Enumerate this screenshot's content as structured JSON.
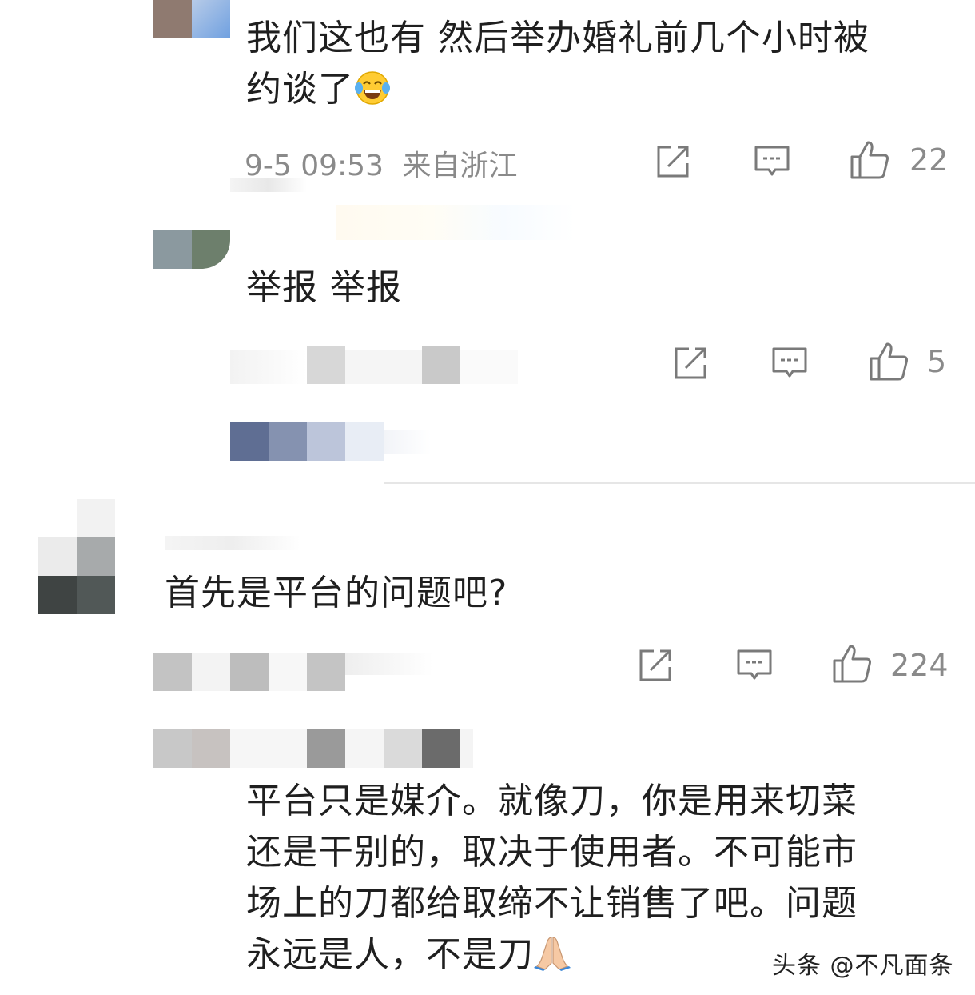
{
  "comments": [
    {
      "text_line1": "我们这也有 然后举办婚礼前几个小时被",
      "text_line2": "约谈了",
      "emoji": "face-with-tears-of-joy",
      "time": "9-5 09:53",
      "location": "来自浙江",
      "likes": "22"
    },
    {
      "text": "举报 举报",
      "likes": "5"
    },
    {
      "text": "首先是平台的问题吧?",
      "likes": "224"
    },
    {
      "lines": [
        "平台只是媒介。就像刀，你是用来切菜",
        "还是干别的，取决于使用者。不可能市",
        "场上的刀都给取缔不让销售了吧。问题",
        "永远是人，不是刀"
      ],
      "emoji": "folded-hands"
    }
  ],
  "watermark": "头条 @不凡面条",
  "colors": {
    "text": "#1f1f1f",
    "meta": "#8a8a8a",
    "icon": "#7a7a7a",
    "divider": "#e6e6e6"
  }
}
